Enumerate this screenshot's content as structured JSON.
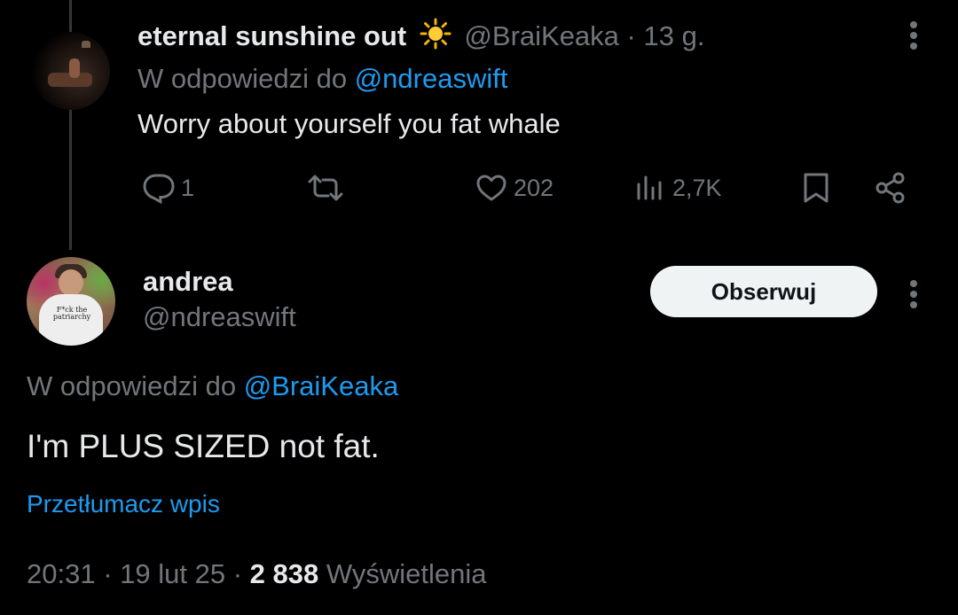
{
  "parent_tweet": {
    "display_name": "eternal sunshine out",
    "name_emoji": "sun-emoji",
    "handle": "@BraiKeaka",
    "separator": "·",
    "time_ago": "13 g.",
    "reply_prefix": "W odpowiedzi do",
    "reply_to": "@ndreaswift",
    "text": "Worry about yourself you fat whale",
    "actions": {
      "reply_count": "1",
      "retweet_count": "",
      "like_count": "202",
      "views_count": "2,7K"
    }
  },
  "main_tweet": {
    "display_name": "andrea",
    "handle": "@ndreaswift",
    "follow_label": "Obserwuj",
    "avatar_shirt_text": "F*ck the patriarchy",
    "reply_prefix": "W odpowiedzi do",
    "reply_to": "@BraiKeaka",
    "text": "I'm PLUS SIZED not fat.",
    "translate_label": "Przetłumacz wpis",
    "time": "20:31",
    "date": "19 lut 25",
    "separator": "·",
    "views_number": "2 838",
    "views_label": "Wyświetlenia"
  },
  "colors": {
    "background": "#000000",
    "text": "#e7e9ea",
    "muted": "#71767b",
    "link": "#1d9bf0",
    "follow_button_bg": "#eff3f4"
  }
}
